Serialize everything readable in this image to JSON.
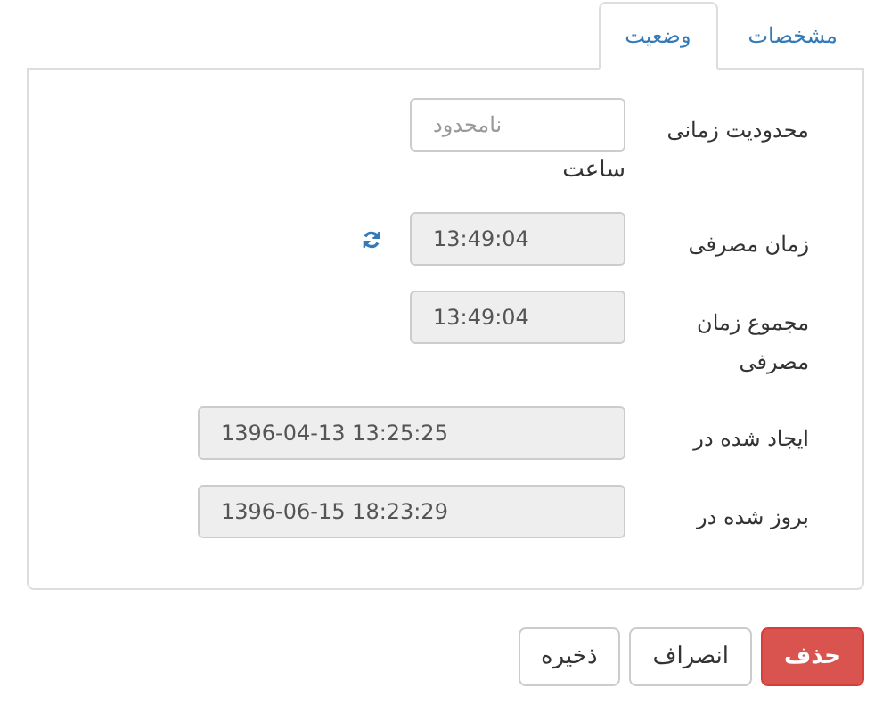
{
  "tabs": [
    {
      "label": "مشخصات",
      "selected": false
    },
    {
      "label": "وضعیت",
      "selected": true
    }
  ],
  "fields": [
    {
      "label": "محدودیت زمانی",
      "kind": "time",
      "placeholder": "نامحدود",
      "disabled": false,
      "unit": "ساعت"
    },
    {
      "label": "زمان مصرفی",
      "kind": "time",
      "value": "13:49:04",
      "disabled": true,
      "refresh": true
    },
    {
      "label": "مجموع زمان مصرفی",
      "kind": "time",
      "value": "13:49:04",
      "disabled": true
    },
    {
      "label": "ایجاد شده در",
      "kind": "datetime",
      "value": "1396-04-13 13:25:25",
      "disabled": true
    },
    {
      "label": "بروز شده در",
      "kind": "datetime",
      "value": "1396-06-15 18:23:29",
      "disabled": true
    }
  ],
  "buttons": [
    {
      "label": "حذف",
      "kind": "danger"
    },
    {
      "label": "انصراف",
      "kind": "default"
    },
    {
      "label": "ذخیره",
      "kind": "default"
    }
  ]
}
